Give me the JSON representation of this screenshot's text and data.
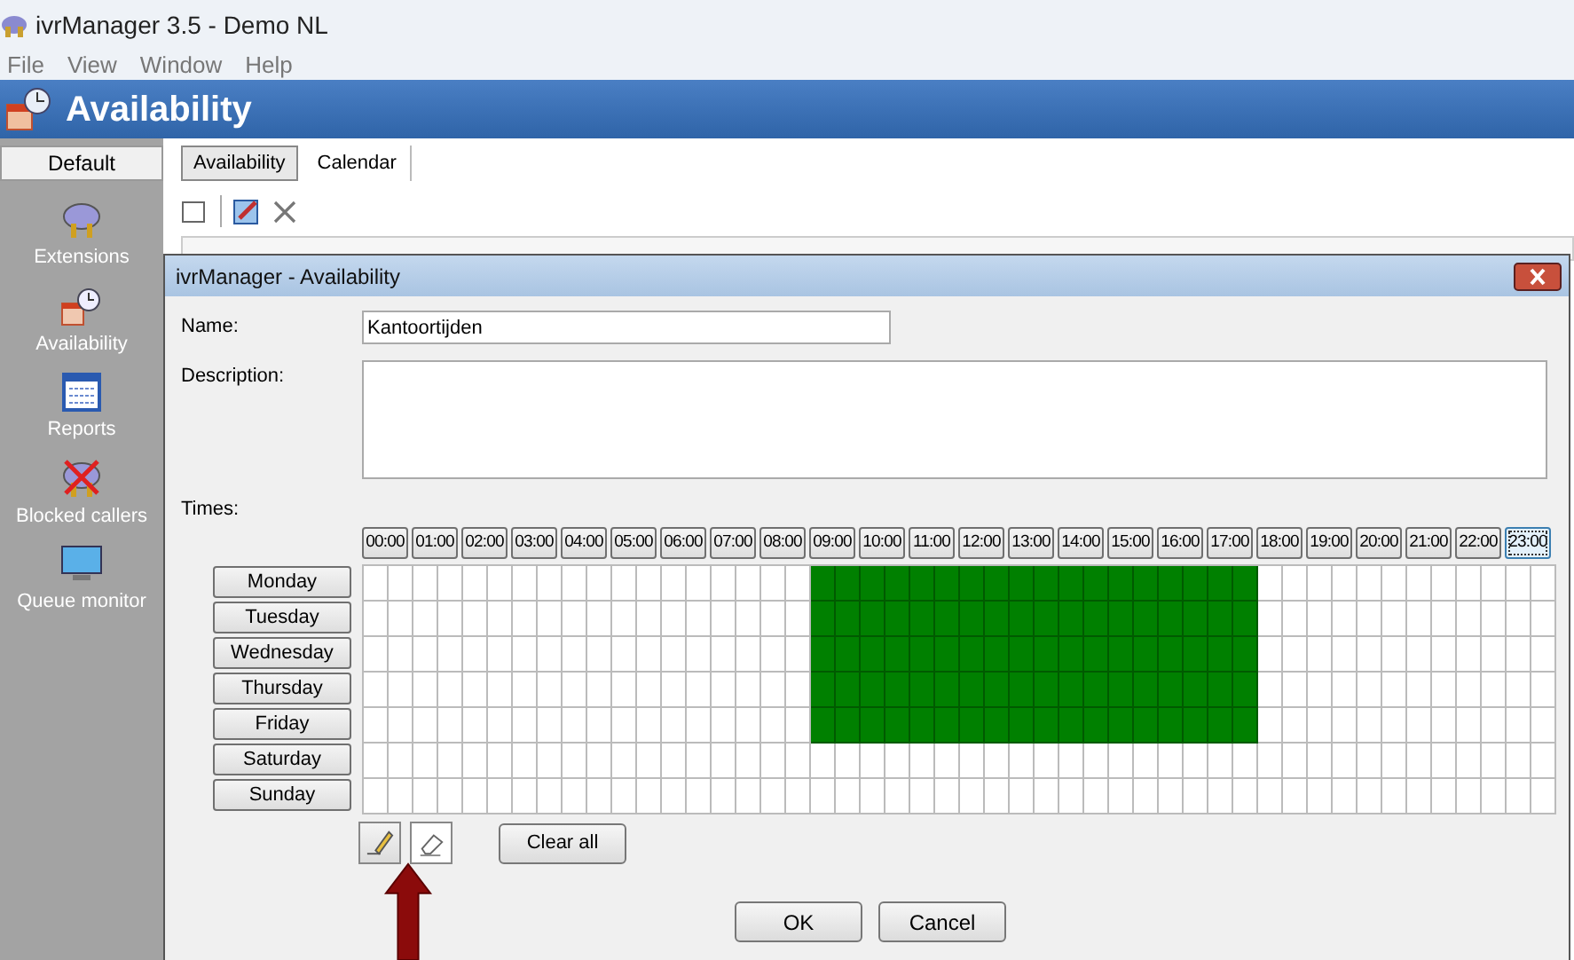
{
  "window": {
    "title": "ivrManager 3.5 - Demo NL"
  },
  "menu": [
    "File",
    "View",
    "Window",
    "Help"
  ],
  "header": {
    "title": "Availability"
  },
  "sidebar": {
    "group": "Default",
    "items": [
      {
        "label": "Extensions",
        "kind": "plug"
      },
      {
        "label": "Availability",
        "kind": "clock"
      },
      {
        "label": "Reports",
        "kind": "calendar"
      },
      {
        "label": "Blocked callers",
        "kind": "blocked"
      },
      {
        "label": "Queue monitor",
        "kind": "monitor"
      }
    ]
  },
  "tabs": [
    {
      "label": "Availability",
      "selected": true
    },
    {
      "label": "Calendar",
      "selected": false
    }
  ],
  "dialog": {
    "title": "ivrManager - Availability",
    "name_label": "Name:",
    "name_value": "Kantoortijden",
    "description_label": "Description:",
    "times_label": "Times:",
    "hours": [
      {
        "label": "00:00",
        "focused": false
      },
      {
        "label": "01:00",
        "focused": false
      },
      {
        "label": "02:00",
        "focused": false
      },
      {
        "label": "03:00",
        "focused": false
      },
      {
        "label": "04:00",
        "focused": false
      },
      {
        "label": "05:00",
        "focused": false
      },
      {
        "label": "06:00",
        "focused": false
      },
      {
        "label": "07:00",
        "focused": false
      },
      {
        "label": "08:00",
        "focused": false
      },
      {
        "label": "09:00",
        "focused": false
      },
      {
        "label": "10:00",
        "focused": false
      },
      {
        "label": "11:00",
        "focused": false
      },
      {
        "label": "12:00",
        "focused": false
      },
      {
        "label": "13:00",
        "focused": false
      },
      {
        "label": "14:00",
        "focused": false
      },
      {
        "label": "15:00",
        "focused": false
      },
      {
        "label": "16:00",
        "focused": false
      },
      {
        "label": "17:00",
        "focused": false
      },
      {
        "label": "18:00",
        "focused": false
      },
      {
        "label": "19:00",
        "focused": false
      },
      {
        "label": "20:00",
        "focused": false
      },
      {
        "label": "21:00",
        "focused": false
      },
      {
        "label": "22:00",
        "focused": false
      },
      {
        "label": "23:00",
        "focused": true
      }
    ],
    "days": [
      {
        "label": "Monday",
        "slots": [
          false,
          false,
          false,
          false,
          false,
          false,
          false,
          false,
          false,
          false,
          false,
          false,
          false,
          false,
          false,
          false,
          false,
          false,
          true,
          true,
          true,
          true,
          true,
          true,
          true,
          true,
          true,
          true,
          true,
          true,
          true,
          true,
          true,
          true,
          true,
          true,
          false,
          false,
          false,
          false,
          false,
          false,
          false,
          false,
          false,
          false,
          false,
          false
        ]
      },
      {
        "label": "Tuesday",
        "slots": [
          false,
          false,
          false,
          false,
          false,
          false,
          false,
          false,
          false,
          false,
          false,
          false,
          false,
          false,
          false,
          false,
          false,
          false,
          true,
          true,
          true,
          true,
          true,
          true,
          true,
          true,
          true,
          true,
          true,
          true,
          true,
          true,
          true,
          true,
          true,
          true,
          false,
          false,
          false,
          false,
          false,
          false,
          false,
          false,
          false,
          false,
          false,
          false
        ]
      },
      {
        "label": "Wednesday",
        "slots": [
          false,
          false,
          false,
          false,
          false,
          false,
          false,
          false,
          false,
          false,
          false,
          false,
          false,
          false,
          false,
          false,
          false,
          false,
          true,
          true,
          true,
          true,
          true,
          true,
          true,
          true,
          true,
          true,
          true,
          true,
          true,
          true,
          true,
          true,
          true,
          true,
          false,
          false,
          false,
          false,
          false,
          false,
          false,
          false,
          false,
          false,
          false,
          false
        ]
      },
      {
        "label": "Thursday",
        "slots": [
          false,
          false,
          false,
          false,
          false,
          false,
          false,
          false,
          false,
          false,
          false,
          false,
          false,
          false,
          false,
          false,
          false,
          false,
          true,
          true,
          true,
          true,
          true,
          true,
          true,
          true,
          true,
          true,
          true,
          true,
          true,
          true,
          true,
          true,
          true,
          true,
          false,
          false,
          false,
          false,
          false,
          false,
          false,
          false,
          false,
          false,
          false,
          false
        ]
      },
      {
        "label": "Friday",
        "slots": [
          false,
          false,
          false,
          false,
          false,
          false,
          false,
          false,
          false,
          false,
          false,
          false,
          false,
          false,
          false,
          false,
          false,
          false,
          true,
          true,
          true,
          true,
          true,
          true,
          true,
          true,
          true,
          true,
          true,
          true,
          true,
          true,
          true,
          true,
          true,
          true,
          false,
          false,
          false,
          false,
          false,
          false,
          false,
          false,
          false,
          false,
          false,
          false
        ]
      },
      {
        "label": "Saturday",
        "slots": [
          false,
          false,
          false,
          false,
          false,
          false,
          false,
          false,
          false,
          false,
          false,
          false,
          false,
          false,
          false,
          false,
          false,
          false,
          false,
          false,
          false,
          false,
          false,
          false,
          false,
          false,
          false,
          false,
          false,
          false,
          false,
          false,
          false,
          false,
          false,
          false,
          false,
          false,
          false,
          false,
          false,
          false,
          false,
          false,
          false,
          false,
          false,
          false
        ]
      },
      {
        "label": "Sunday",
        "slots": [
          false,
          false,
          false,
          false,
          false,
          false,
          false,
          false,
          false,
          false,
          false,
          false,
          false,
          false,
          false,
          false,
          false,
          false,
          false,
          false,
          false,
          false,
          false,
          false,
          false,
          false,
          false,
          false,
          false,
          false,
          false,
          false,
          false,
          false,
          false,
          false,
          false,
          false,
          false,
          false,
          false,
          false,
          false,
          false,
          false,
          false,
          false,
          false
        ]
      }
    ],
    "tools": [
      {
        "kind": "pencil",
        "selected": false
      },
      {
        "kind": "eraser",
        "selected": true
      }
    ],
    "clear_button": "Clear all",
    "buttons": [
      "OK",
      "Cancel"
    ]
  }
}
